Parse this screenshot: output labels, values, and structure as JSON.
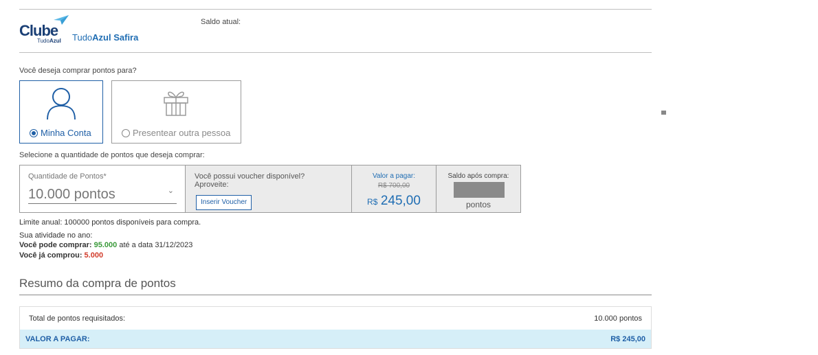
{
  "header": {
    "logo_main": "Clube",
    "logo_sub_light": "Tudo",
    "logo_sub_bold": "Azul",
    "brand_light": "Tudo",
    "brand_bold": "Azul Safira",
    "saldo_atual_label": "Saldo atual:"
  },
  "purchase_for": {
    "question": "Você deseja comprar pontos para?",
    "options": [
      {
        "label": "Minha Conta",
        "icon": "person-icon",
        "selected": true
      },
      {
        "label": "Presentear outra pessoa",
        "icon": "gift-icon",
        "selected": false
      }
    ]
  },
  "quantity": {
    "question": "Selecione a quantidade de pontos que deseja comprar:",
    "field_label": "Quantidade de Pontos*",
    "selected_value": "10.000 pontos",
    "voucher_text": "Você possui voucher disponível? Aproveite:",
    "voucher_button": "Inserir Voucher",
    "valor_label": "Valor a pagar:",
    "valor_old": "R$ 700,00",
    "valor_currency": "R$",
    "valor_new": "245,00",
    "saldo_label": "Saldo após compra:",
    "saldo_unit": "pontos"
  },
  "limits": {
    "annual": "Limite anual: 100000 pontos disponíveis para compra.",
    "activity_title": "Sua atividade no ano:",
    "can_buy_label": "Você pode comprar:",
    "can_buy_value": "95.000",
    "can_buy_suffix": "até a data 31/12/2023",
    "bought_label": "Você já comprou:",
    "bought_value": "5.000"
  },
  "summary": {
    "title": "Resumo da compra de pontos",
    "rows": [
      {
        "label": "Total de pontos requisitados:",
        "value": "10.000 pontos"
      }
    ],
    "total_label": "VALOR A PAGAR:",
    "total_value": "R$ 245,00"
  },
  "colors": {
    "accent": "#1f5fa6",
    "green": "#3a9a3a",
    "red": "#d23b2a",
    "total_bg": "#d6eff8"
  }
}
